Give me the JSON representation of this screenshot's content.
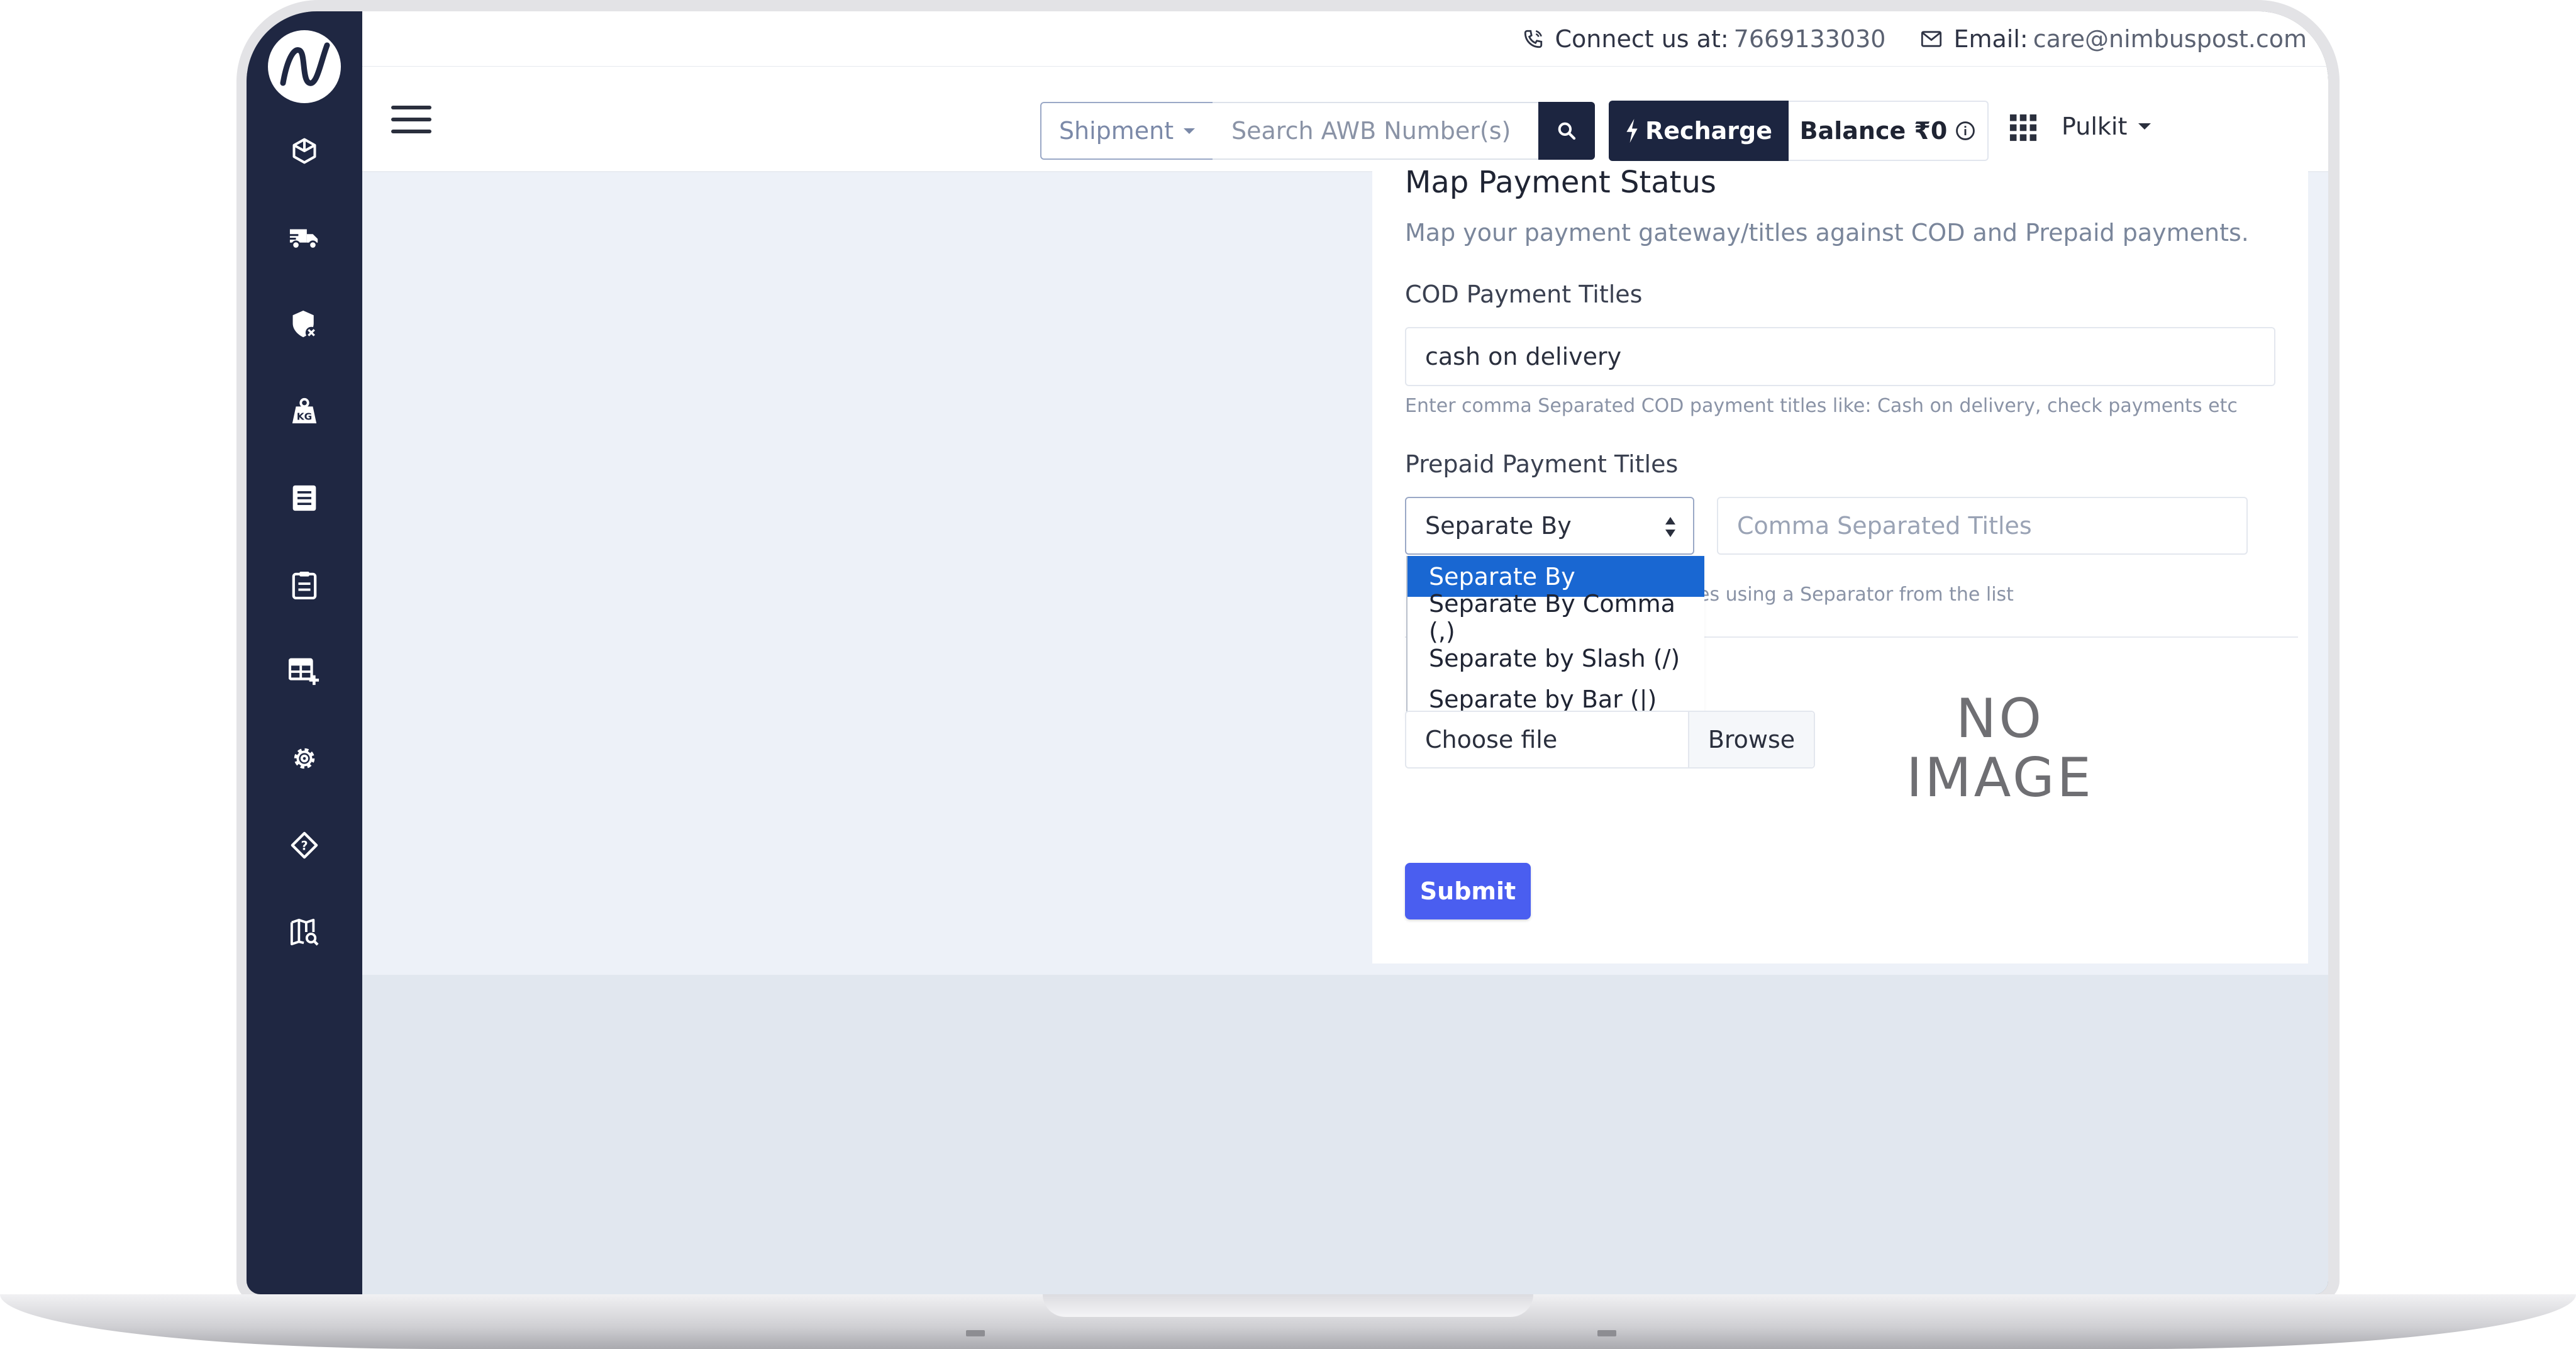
{
  "contact": {
    "phone_label": "Connect us at: ",
    "phone": "7669133030",
    "email_label": "Email: ",
    "email": "care@nimbuspost.com"
  },
  "navbar": {
    "shipment_label": "Shipment",
    "search_placeholder": "Search AWB Number(s)",
    "recharge_label": "Recharge",
    "balance_label": "Balance ₹0",
    "user_name": "Pulkit"
  },
  "sidebar": {
    "items": [
      {
        "icon": "box-icon"
      },
      {
        "icon": "truck-icon"
      },
      {
        "icon": "shield-x-icon"
      },
      {
        "icon": "weight-kg-icon"
      },
      {
        "icon": "list-icon"
      },
      {
        "icon": "clipboard-icon"
      },
      {
        "icon": "table-add-icon"
      },
      {
        "icon": "gear-icon"
      },
      {
        "icon": "help-diamond-icon"
      },
      {
        "icon": "map-search-icon"
      }
    ]
  },
  "form": {
    "title": "Map Payment Status",
    "subtitle": "Map your payment gateway/titles against COD and Prepaid payments.",
    "cod_label": "COD Payment Titles",
    "cod_value": "cash on delivery",
    "cod_help": "Enter comma Separated COD payment titles like: Cash on delivery, check payments etc",
    "prepaid_label": "Prepaid Payment Titles",
    "separator_selected": "Separate By",
    "separator_options": [
      "Separate By",
      "Separate By Comma (,)",
      "Separate by Slash (/)",
      "Separate by Bar (|)"
    ],
    "titles_placeholder": "Comma Separated Titles",
    "prepaid_help_visible": "es using a Separator from the list",
    "file_choose": "Choose file",
    "file_browse": "Browse",
    "no_image_line1": "NO",
    "no_image_line2": "IMAGE",
    "submit_label": "Submit"
  },
  "colors": {
    "sidebar_bg": "#1f2742",
    "navbar_dark": "#1c2540",
    "submit": "#4a5ef0",
    "selected_option": "#1967d2"
  }
}
